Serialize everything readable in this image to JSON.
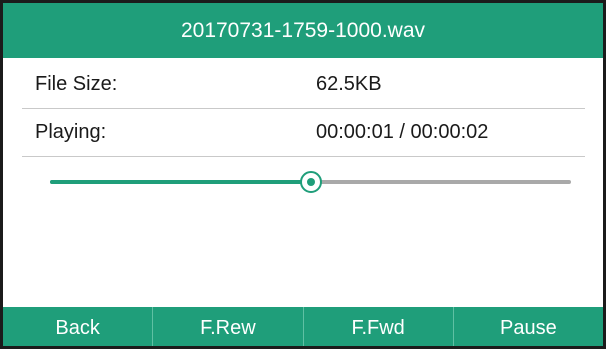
{
  "title": "20170731-1759-1000.wav",
  "file_size": {
    "label": "File Size:",
    "value": "62.5KB"
  },
  "playing": {
    "label": "Playing:",
    "value": "00:00:01 / 00:00:02",
    "progress_percent": 50
  },
  "softkeys": [
    {
      "label": "Back"
    },
    {
      "label": "F.Rew"
    },
    {
      "label": "F.Fwd"
    },
    {
      "label": "Pause"
    }
  ],
  "colors": {
    "accent": "#1f9e7a",
    "track": "#a9a9a9",
    "text": "#1a1a1a",
    "divider": "#c9c9c9"
  }
}
